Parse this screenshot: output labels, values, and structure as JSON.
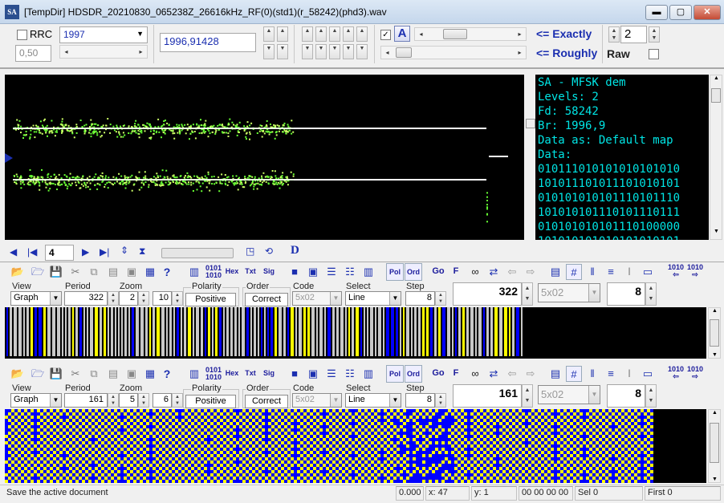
{
  "window": {
    "title": "[TempDir] HDSDR_20210830_065238Z_26616kHz_RF(0)(std1)(r_58242)(phd3).wav",
    "app_icon_text": "SA",
    "minimize": "▬",
    "maximize": "▢",
    "close": "✕"
  },
  "top": {
    "rrc_label": "RRC",
    "rrc_value": "0,50",
    "year_select": "1997",
    "freq_value": "1996,91428",
    "exactly_label": "<= Exactly",
    "roughly_label": "<= Roughly",
    "a_button": "A",
    "count_value": "2",
    "raw_label": "Raw"
  },
  "decoder_text": {
    "lines": [
      "SA - MFSK dem",
      "Levels: 2",
      "Fd: 58242",
      "Br: 1996,9",
      "Data as: Default map",
      "Data:",
      "010111010101010101010",
      "101011101011101010101",
      "010101010101110101110",
      "101010101110101110111",
      "010101010101110100000",
      "101010101010101010101"
    ]
  },
  "nav": {
    "page_value": "4"
  },
  "toolbar": {
    "hex": "Hex",
    "txt": "Txt",
    "sig": "Sig",
    "bits_top": "0101",
    "bits_bottom": "1010",
    "pol": "Pol",
    "ord": "Ord",
    "go": "Go",
    "f": "F",
    "help": "?"
  },
  "panel1": {
    "view_label": "View",
    "view_value": "Graph",
    "period_label": "Period",
    "period_value": "322",
    "zoom_label": "Zoom",
    "zoom_a": "2",
    "zoom_b": "10",
    "polarity_label": "Polarity",
    "polarity_value": "Positive",
    "order_label": "Order",
    "order_value": "Correct",
    "code_label": "Code",
    "code_value": "5x02",
    "select_label": "Select",
    "select_value": "Line",
    "step_label": "Step",
    "step_value": "8",
    "big_value": "322",
    "code2_value": "5x02",
    "right_value": "8"
  },
  "panel2": {
    "view_label": "View",
    "view_value": "Graph",
    "period_label": "Period",
    "period_value": "161",
    "zoom_label": "Zoom",
    "zoom_a": "5",
    "zoom_b": "6",
    "polarity_label": "Polarity",
    "polarity_value": "Positive",
    "order_label": "Order",
    "order_value": "Correct",
    "code_label": "Code",
    "code_value": "5x02",
    "select_label": "Select",
    "select_value": "Line",
    "step_label": "Step",
    "step_value": "8",
    "big_value": "161",
    "code2_value": "5x02",
    "right_value": "8"
  },
  "status": {
    "message": "Save the active document",
    "value": "0.000",
    "x": "x: 47",
    "y": "y: 1",
    "hex": "00 00 00 00",
    "sel": "Sel 0",
    "first": "First 0"
  },
  "colors": {
    "accent_blue": "#0000ff",
    "accent_yellow": "#ffff00",
    "signal_green": "#66ff33",
    "cyan_text": "#00e5e5"
  }
}
